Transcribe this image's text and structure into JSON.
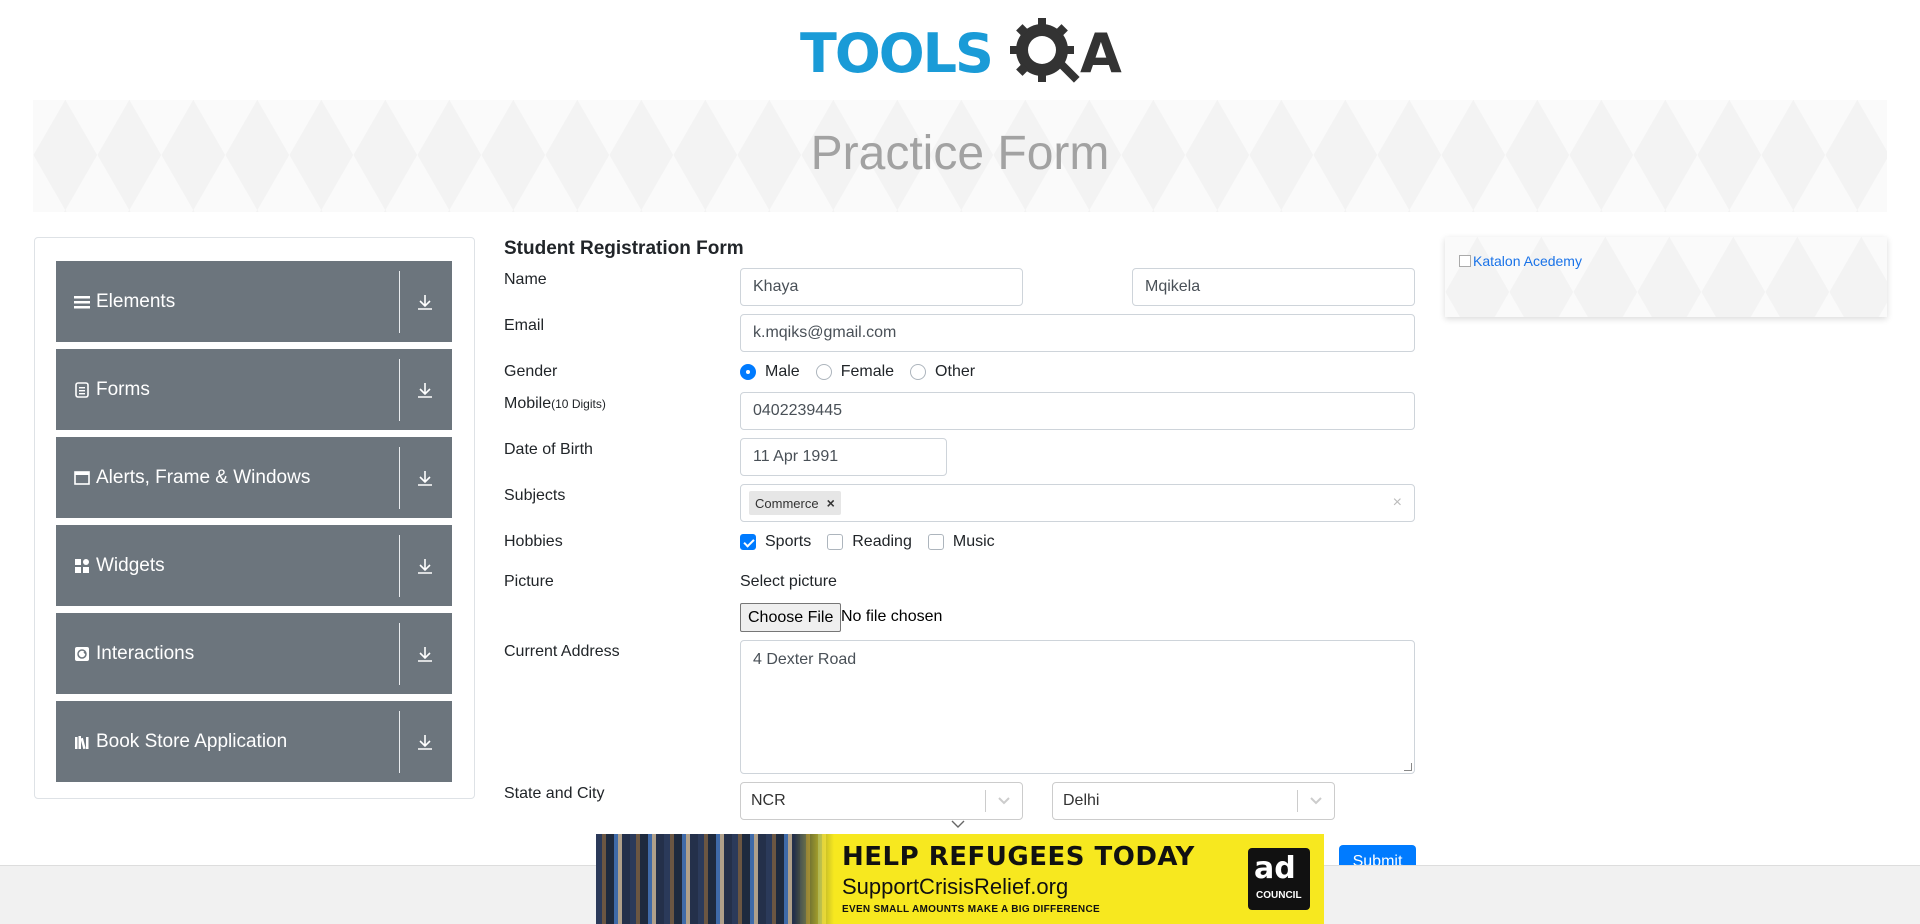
{
  "header": {
    "logo_text_blue": "TOOLS",
    "logo_text_dark": "A",
    "brand_colors": {
      "blue": "#1a9bd7",
      "dark": "#333333"
    }
  },
  "banner": {
    "title": "Practice Form"
  },
  "sidebar": {
    "items": [
      {
        "label": "Elements",
        "icon": "hamburger-icon"
      },
      {
        "label": "Forms",
        "icon": "document-icon"
      },
      {
        "label": "Alerts, Frame & Windows",
        "icon": "window-icon"
      },
      {
        "label": "Widgets",
        "icon": "widgets-icon"
      },
      {
        "label": "Interactions",
        "icon": "interactions-icon"
      },
      {
        "label": "Book Store Application",
        "icon": "books-icon"
      }
    ],
    "bg_color": "#6c757d"
  },
  "form": {
    "title": "Student Registration Form",
    "name_label": "Name",
    "first_name": "Khaya",
    "last_name": "Mqikela",
    "email_label": "Email",
    "email": "k.mqiks@gmail.com",
    "gender_label": "Gender",
    "gender_options": [
      "Male",
      "Female",
      "Other"
    ],
    "gender_selected": "Male",
    "mobile_label": "Mobile",
    "mobile_hint": "(10 Digits)",
    "mobile": "0402239445",
    "dob_label": "Date of Birth",
    "dob": "11 Apr 1991",
    "subjects_label": "Subjects",
    "subjects": [
      "Commerce"
    ],
    "chip_remove": "×",
    "subjects_clear": "×",
    "hobbies_label": "Hobbies",
    "hobbies": [
      {
        "label": "Sports",
        "checked": true
      },
      {
        "label": "Reading",
        "checked": false
      },
      {
        "label": "Music",
        "checked": false
      }
    ],
    "picture_label": "Picture",
    "picture_hint": "Select picture",
    "file_button": "Choose File",
    "file_status": "No file chosen",
    "address_label": "Current Address",
    "address": "4 Dexter Road",
    "state_city_label": "State and City",
    "state": "NCR",
    "city": "Delhi",
    "submit": "Submit",
    "accent_color": "#007bff"
  },
  "right_ad": {
    "alt_text": "Katalon Acedemy"
  },
  "bottom_ad": {
    "headline": "HELP REFUGEES TODAY",
    "url": "SupportCrisisRelief.org",
    "tagline": "EVEN SMALL AMOUNTS MAKE A BIG DIFFERENCE",
    "badge_top": "ad",
    "badge_bottom": "COUNCIL",
    "bg_color": "#f7e81f"
  }
}
